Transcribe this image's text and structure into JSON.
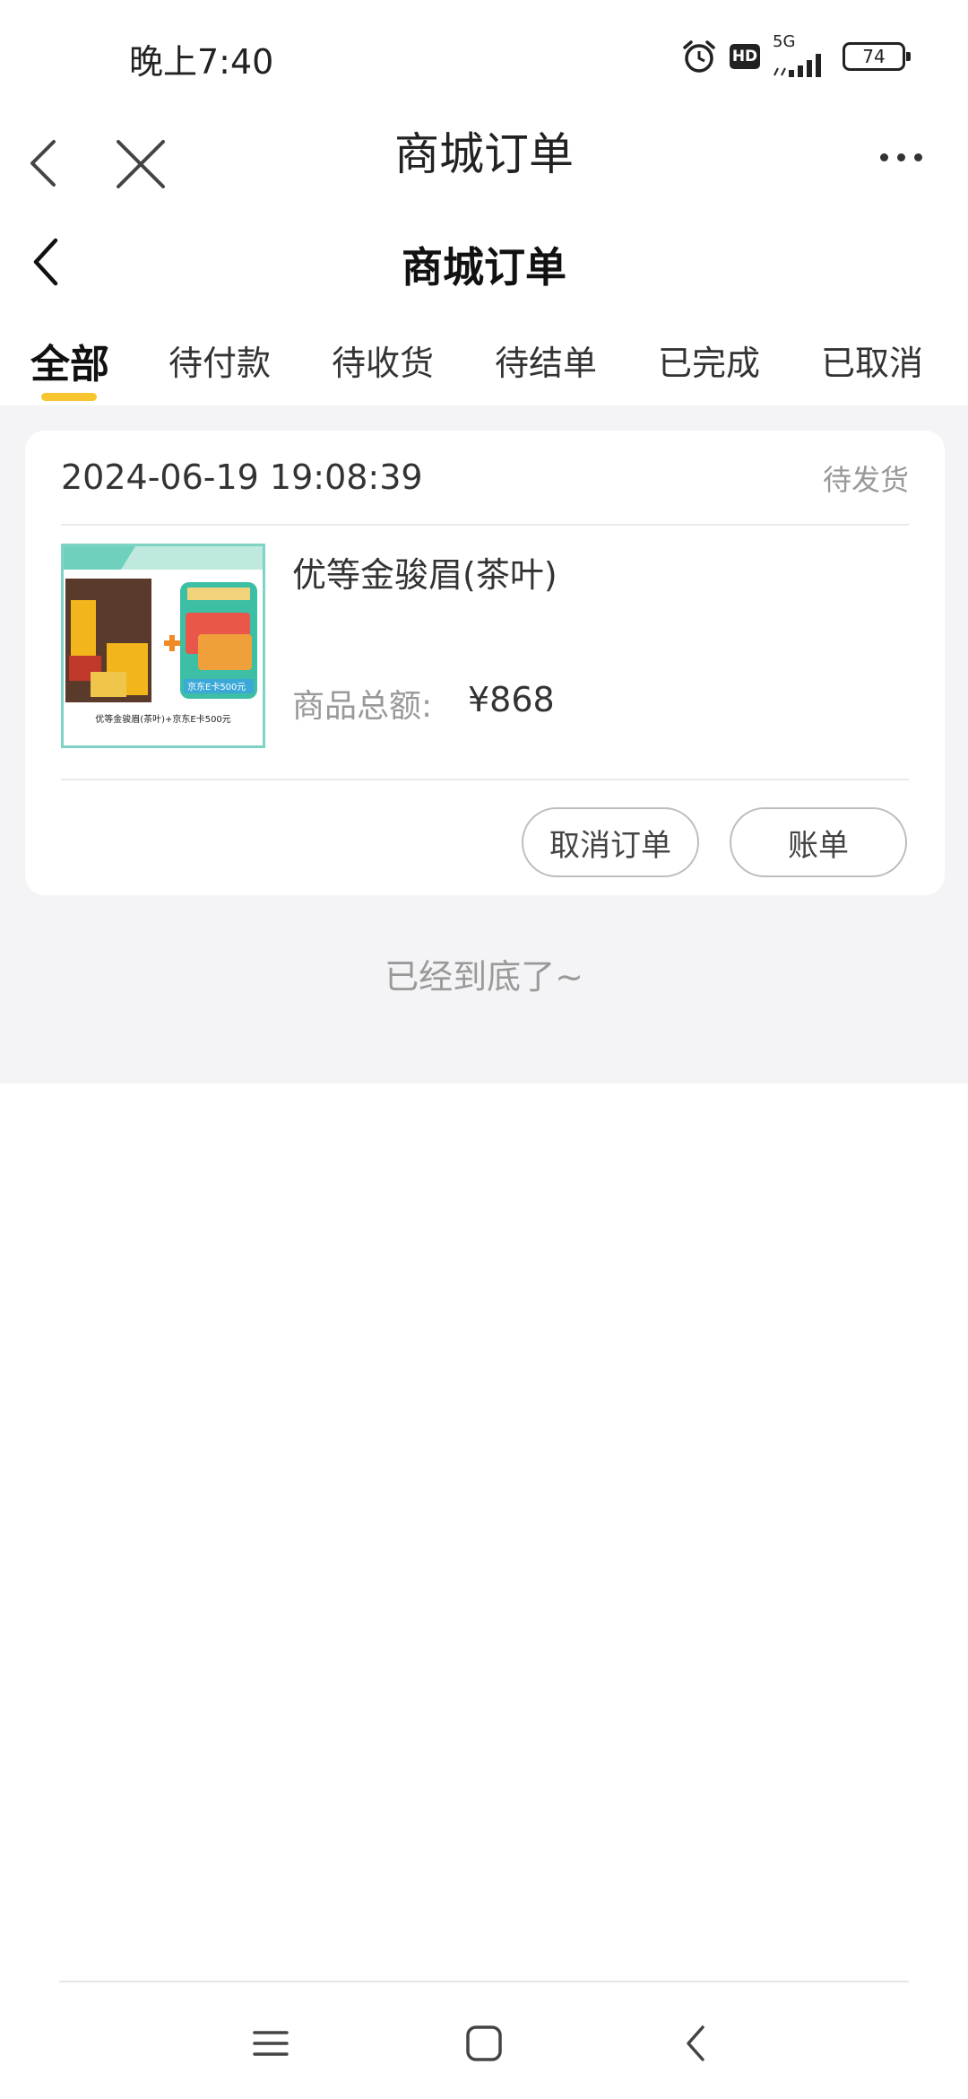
{
  "status_bar": {
    "time": "晚上7:40",
    "hd": "HD",
    "network": "5G",
    "battery": "74",
    "icons": [
      "alarm-icon",
      "hd-icon",
      "signal-icon",
      "battery-icon"
    ]
  },
  "browser_bar": {
    "title": "商城订单",
    "icons": [
      "back-icon",
      "close-icon",
      "more-icon"
    ]
  },
  "page_header": {
    "title": "商城订单"
  },
  "tabs": [
    {
      "label": "全部",
      "active": true
    },
    {
      "label": "待付款",
      "active": false
    },
    {
      "label": "待收货",
      "active": false
    },
    {
      "label": "待结单",
      "active": false
    },
    {
      "label": "已完成",
      "active": false
    },
    {
      "label": "已取消",
      "active": false
    }
  ],
  "orders": [
    {
      "time": "2024-06-19 19:08:39",
      "status": "待发货",
      "product_name": "优等金骏眉(茶叶)",
      "price_label": "商品总额:",
      "price_value": "¥868",
      "thumbnail_caption": "优等金骏眉(茶叶)+京东E卡500元",
      "thumbnail_card_label": "京东E卡500元",
      "buttons": {
        "cancel": "取消订单",
        "bill": "账单"
      }
    }
  ],
  "end_text": "已经到底了~",
  "bottom_nav": [
    "menu-icon",
    "home-icon",
    "back-icon"
  ],
  "colors": {
    "accent": "#f8c52f",
    "background": "#f4f4f6",
    "muted_text": "#999999"
  }
}
